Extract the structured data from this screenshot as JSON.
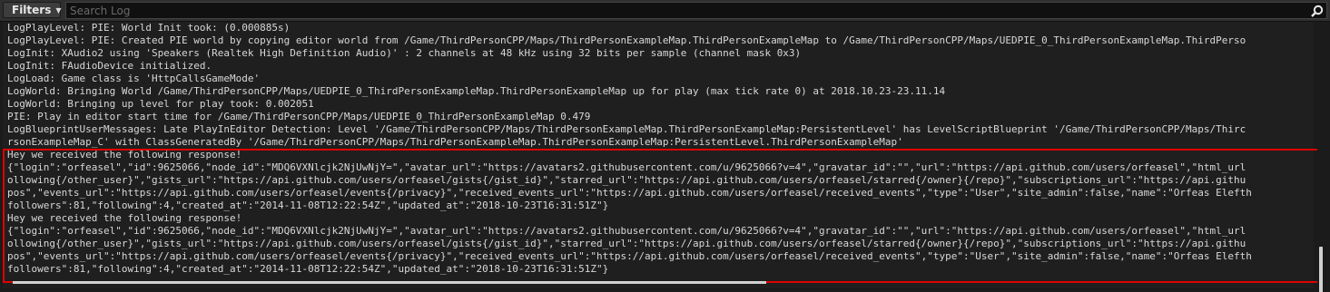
{
  "toolbar": {
    "filters_label": "Filters",
    "search_placeholder": "Search Log"
  },
  "log": {
    "lines": [
      "LogPlayLevel: PIE: World Init took: (0.000885s)",
      "LogPlayLevel: PIE: Created PIE world by copying editor world from /Game/ThirdPersonCPP/Maps/ThirdPersonExampleMap.ThirdPersonExampleMap to /Game/ThirdPersonCPP/Maps/UEDPIE_0_ThirdPersonExampleMap.ThirdPerso",
      "LogInit: XAudio2 using 'Speakers (Realtek High Definition Audio)' : 2 channels at 48 kHz using 32 bits per sample (channel mask 0x3)",
      "LogInit: FAudioDevice initialized.",
      "LogLoad: Game class is 'HttpCallsGameMode'",
      "LogWorld: Bringing World /Game/ThirdPersonCPP/Maps/UEDPIE_0_ThirdPersonExampleMap.ThirdPersonExampleMap up for play (max tick rate 0) at 2018.10.23-23.11.14",
      "LogWorld: Bringing up level for play took: 0.002051",
      "PIE: Play in editor start time for /Game/ThirdPersonCPP/Maps/UEDPIE_0_ThirdPersonExampleMap 0.479",
      "LogBlueprintUserMessages: Late PlayInEditor Detection: Level '/Game/ThirdPersonCPP/Maps/ThirdPersonExampleMap.ThirdPersonExampleMap:PersistentLevel' has LevelScriptBlueprint '/Game/ThirdPersonCPP/Maps/Thirc",
      "rsonExampleMap_C' with ClassGeneratedBy '/Game/ThirdPersonCPP/Maps/ThirdPersonExampleMap.ThirdPersonExampleMap:PersistentLevel.ThirdPersonExampleMap'",
      "Hey we received the following response!",
      "{\"login\":\"orfeasel\",\"id\":9625066,\"node_id\":\"MDQ6VXNlcjk2NjUwNjY=\",\"avatar_url\":\"https://avatars2.githubusercontent.com/u/9625066?v=4\",\"gravatar_id\":\"\",\"url\":\"https://api.github.com/users/orfeasel\",\"html_url",
      "ollowing{/other_user}\",\"gists_url\":\"https://api.github.com/users/orfeasel/gists{/gist_id}\",\"starred_url\":\"https://api.github.com/users/orfeasel/starred{/owner}{/repo}\",\"subscriptions_url\":\"https://api.githu",
      "pos\",\"events_url\":\"https://api.github.com/users/orfeasel/events{/privacy}\",\"received_events_url\":\"https://api.github.com/users/orfeasel/received_events\",\"type\":\"User\",\"site_admin\":false,\"name\":\"Orfeas Elefth",
      "followers\":81,\"following\":4,\"created_at\":\"2014-11-08T12:22:54Z\",\"updated_at\":\"2018-10-23T16:31:51Z\"}",
      "Hey we received the following response!",
      "{\"login\":\"orfeasel\",\"id\":9625066,\"node_id\":\"MDQ6VXNlcjk2NjUwNjY=\",\"avatar_url\":\"https://avatars2.githubusercontent.com/u/9625066?v=4\",\"gravatar_id\":\"\",\"url\":\"https://api.github.com/users/orfeasel\",\"html_url",
      "ollowing{/other_user}\",\"gists_url\":\"https://api.github.com/users/orfeasel/gists{/gist_id}\",\"starred_url\":\"https://api.github.com/users/orfeasel/starred{/owner}{/repo}\",\"subscriptions_url\":\"https://api.githu",
      "pos\",\"events_url\":\"https://api.github.com/users/orfeasel/events{/privacy}\",\"received_events_url\":\"https://api.github.com/users/orfeasel/received_events\",\"type\":\"User\",\"site_admin\":false,\"name\":\"Orfeas Elefth",
      "followers\":81,\"following\":4,\"created_at\":\"2014-11-08T12:22:54Z\",\"updated_at\":\"2018-10-23T16:31:51Z\"}"
    ]
  },
  "colors": {
    "highlight": "#e00000",
    "text": "#d8d8d8",
    "background": "#1f1f1f"
  }
}
